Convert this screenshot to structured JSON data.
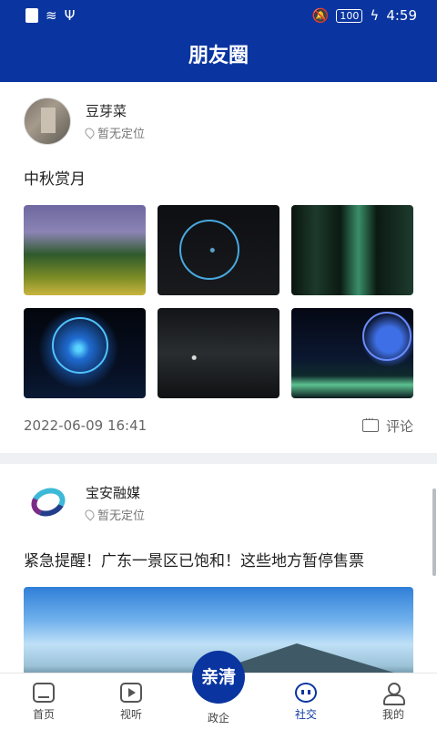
{
  "status_bar": {
    "time": "4:59",
    "battery": "100"
  },
  "header": {
    "title": "朋友圈"
  },
  "posts": [
    {
      "author": "豆芽菜",
      "location": "暂无定位",
      "text": "中秋赏月",
      "date": "2022-06-09 16:41",
      "comment_label": "评论"
    },
    {
      "author": "宝安融媒",
      "location": "暂无定位",
      "text": "紧急提醒！广东一景区已饱和！这些地方暂停售票"
    }
  ],
  "tabbar": {
    "items": [
      {
        "label": "首页"
      },
      {
        "label": "视听"
      },
      {
        "label": "政企"
      },
      {
        "label": "社交"
      },
      {
        "label": "我的"
      }
    ],
    "center_button": "亲清"
  },
  "colors": {
    "brand": "#0a35a0"
  }
}
